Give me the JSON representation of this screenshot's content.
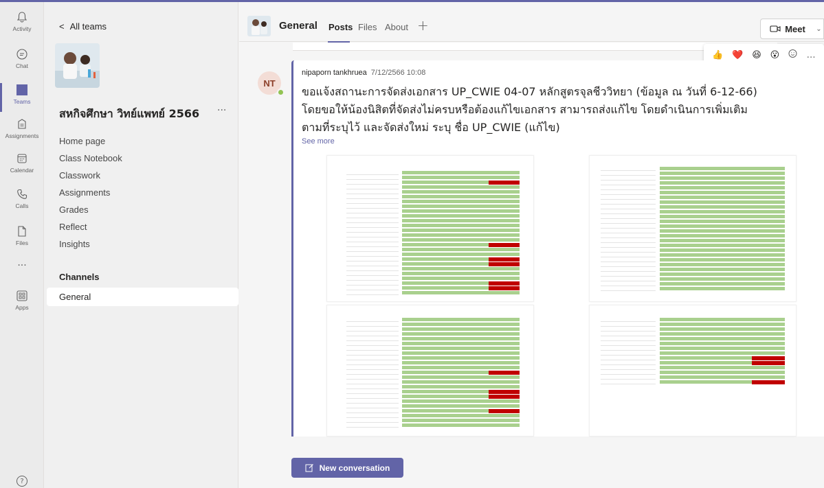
{
  "rail": {
    "items": [
      {
        "label": "Activity",
        "icon": "bell-icon"
      },
      {
        "label": "Chat",
        "icon": "chat-icon"
      },
      {
        "label": "Teams",
        "icon": "teams-icon"
      },
      {
        "label": "Assignments",
        "icon": "assignments-icon"
      },
      {
        "label": "Calendar",
        "icon": "calendar-icon"
      },
      {
        "label": "Calls",
        "icon": "phone-icon"
      },
      {
        "label": "Files",
        "icon": "file-icon"
      },
      {
        "label": "Apps",
        "icon": "apps-icon"
      }
    ],
    "more": "···",
    "help": "?"
  },
  "pane": {
    "back_label": "All teams",
    "team_name": "สหกิจศึกษา วิทย์แพทย์ 2566",
    "team_more": "···",
    "nav": [
      "Home page",
      "Class Notebook",
      "Classwork",
      "Assignments",
      "Grades",
      "Reflect",
      "Insights"
    ],
    "channels_heading": "Channels",
    "channels": [
      "General"
    ]
  },
  "header": {
    "channel_title": "General",
    "tabs": [
      "Posts",
      "Files",
      "About"
    ],
    "add_tab": "+",
    "meet_label": "Meet",
    "meet_chevron": "⌄"
  },
  "reactions": [
    "👍",
    "❤️",
    "😆",
    "😮",
    "😡",
    "…"
  ],
  "post": {
    "avatar_initials": "NT",
    "author": "nipaporn tankhruea",
    "timestamp": "7/12/2566 10:08",
    "lines": [
      "ขอแจ้งสถานะการจัดส่งเอกสาร UP_CWIE 04-07 หลักสูตรจุลชีววิทยา (ข้อมูล ณ วันที่ 6-12-66)",
      "โดยขอให้น้องนิสิตที่จัดส่งไม่ครบหรือต้องแก้ไขเอกสาร สามารถส่งแก้ไข โดยดำเนินการเพิ่มเติม",
      "ตามที่ระบุไว้ และจัดส่งใหม่ ระบุ ชื่อ UP_CWIE (แก้ไข)"
    ],
    "see_more": "See more"
  },
  "compose": {
    "new_conversation": "New conversation"
  },
  "colors": {
    "accent": "#6264a7",
    "sheet_green": "#a9d08e",
    "sheet_red": "#c00000",
    "sheet_orange": "#f4b183"
  }
}
